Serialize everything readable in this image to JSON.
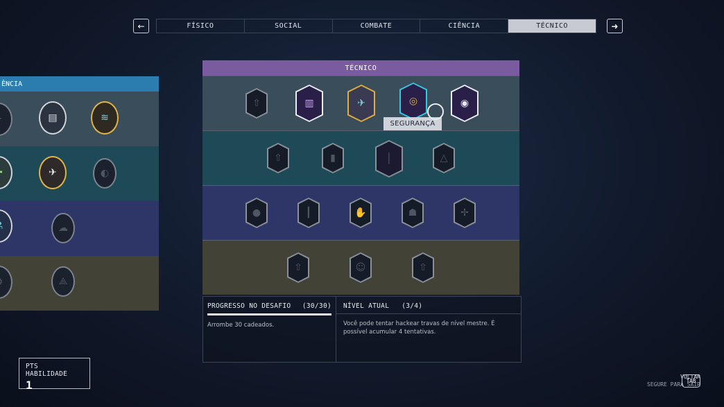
{
  "nav": {
    "prev_arrow": "←",
    "next_arrow": "➜",
    "tabs": [
      "FÍSICO",
      "SOCIAL",
      "COMBATE",
      "CIÊNCIA",
      "TÉCNICO"
    ],
    "active_tab": "TÉCNICO"
  },
  "left_tree": {
    "header": "ÊNCIA"
  },
  "tree": {
    "header": "TÉCNICO",
    "tooltip": "SEGURANÇA"
  },
  "challenge": {
    "title": "PROGRESSO NO DESAFIO",
    "count": "(30/30)",
    "progress": 1.0,
    "description": "Arrombe 30 cadeados."
  },
  "rank": {
    "title": "NÍVEL ATUAL",
    "value": "(3/4)",
    "description": "Você pode tentar hackear travas de nível mestre. É possível acumular 4 tentativas."
  },
  "skill_points": {
    "label": "PTS HABILIDADE",
    "value": "1"
  },
  "back": {
    "label": "VOLTAR",
    "hint": "SEGURE PARA SAIR",
    "key": "TAB"
  },
  "colors": {
    "tecnico": "#7a5b9f",
    "ciencia": "#2b7db0",
    "row1": "#3a4d5b",
    "row2": "#1e4a57",
    "row3": "#2e3567",
    "row4": "#434236"
  }
}
